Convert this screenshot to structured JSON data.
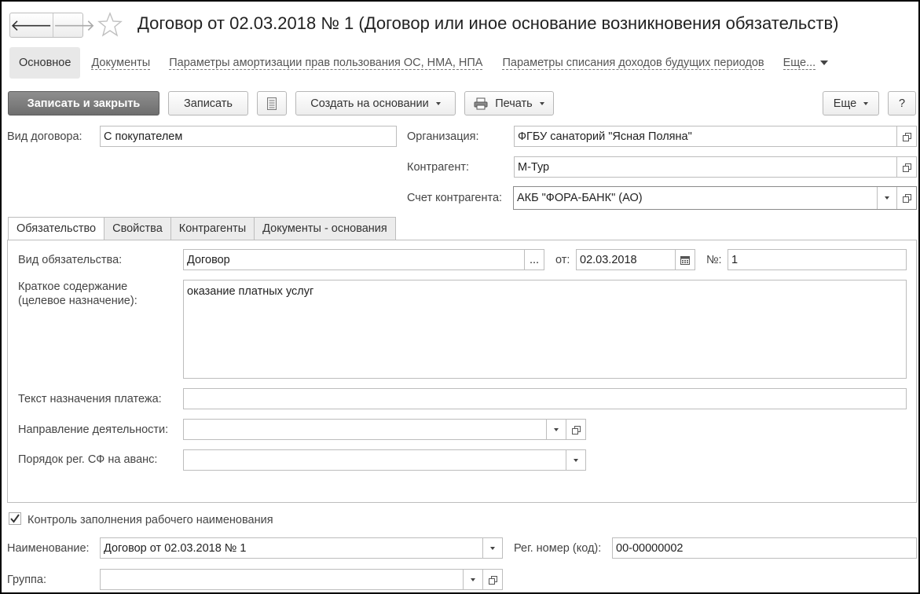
{
  "window": {
    "title": "Договор от 02.03.2018 № 1 (Договор или иное основание возникновения обязательств)",
    "nav_back": "🡐",
    "nav_forward": "🡒"
  },
  "subtabs": [
    "Основное",
    "Документы",
    "Параметры амортизации прав пользования ОС, НМА, НПА",
    "Параметры списания доходов будущих периодов",
    "Еще..."
  ],
  "toolbar": {
    "save_close": "Записать и закрыть",
    "save": "Записать",
    "create_based": "Создать на основании",
    "print": "Печать",
    "more": "Еще",
    "help": "?"
  },
  "header_fields": {
    "contract_type_label": "Вид договора:",
    "contract_type_value": "С покупателем",
    "organization_label": "Организация:",
    "organization_value": "ФГБУ санаторий \"Ясная Поляна\"",
    "counterparty_label": "Контрагент:",
    "counterparty_value": "М-Тур",
    "account_label": "Счет контрагента:",
    "account_value": "АКБ \"ФОРА-БАНК\" (АО)"
  },
  "tabs": [
    "Обязательство",
    "Свойства",
    "Контрагенты",
    "Документы - основания"
  ],
  "obligation": {
    "type_label": "Вид обязательства:",
    "type_value": "Договор",
    "type_button": "...",
    "date_label": "от:",
    "date_value": "02.03.2018",
    "number_label": "№:",
    "number_value": "1",
    "summary_label_1": "Краткое содержание",
    "summary_label_2": "(целевое назначение):",
    "summary_value": "оказание платных услуг",
    "payment_text_label": "Текст назначения платежа:",
    "payment_text_value": "",
    "activity_label": "Направление деятельности:",
    "activity_value": "",
    "invoice_order_label": "Порядок рег. СФ на аванс:",
    "invoice_order_value": ""
  },
  "footer": {
    "control_label": "Контроль заполнения рабочего наименования",
    "control_checked": true,
    "name_label": "Наименование:",
    "name_value": "Договор от 02.03.2018 № 1",
    "regnum_label": "Рег. номер (код):",
    "regnum_value": "00-00000002",
    "group_label": "Группа:",
    "group_value": ""
  }
}
